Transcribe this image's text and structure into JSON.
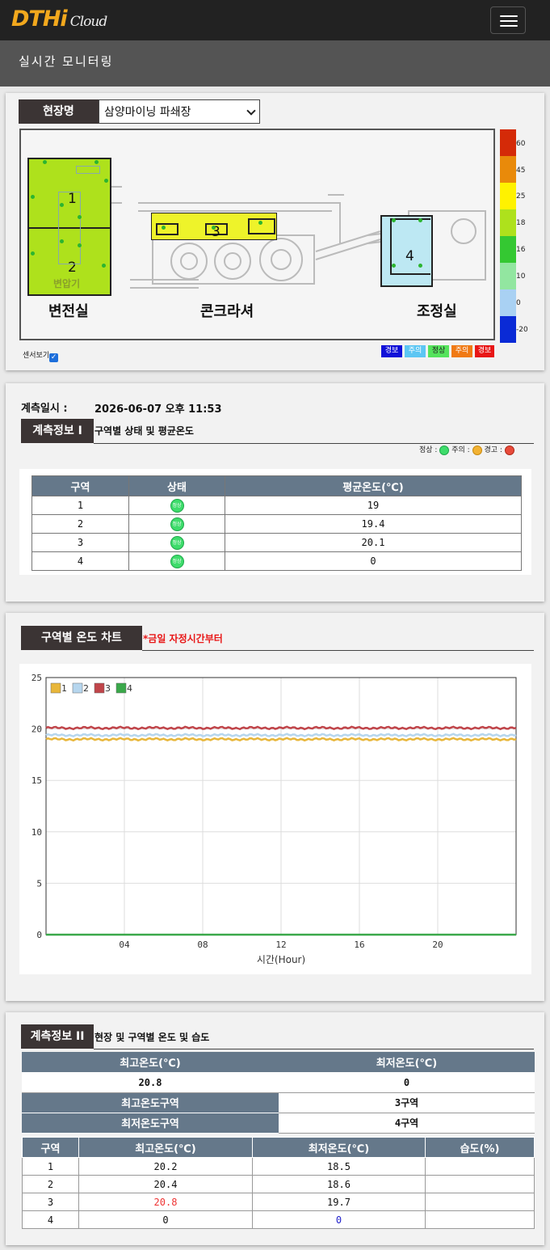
{
  "header": {
    "logo_main": "DTHi",
    "logo_sub": "Cloud",
    "menu_icon": "hamburger-menu-icon",
    "page_title": "실시간 모니터링"
  },
  "site": {
    "label": "현장명",
    "selected": "삼양마이닝 파쇄장",
    "sensor_toggle_label": "센서보기",
    "sensor_toggle_checked": true,
    "map": {
      "zones": [
        "1",
        "2",
        "3",
        "4"
      ],
      "rooms": [
        "변전실",
        "콘크라셔",
        "조정실"
      ],
      "sub_label": "변압기"
    },
    "scale": {
      "labels": [
        "60",
        "45",
        "25",
        "18",
        "16",
        "10",
        "0",
        "-20"
      ],
      "colors": [
        "#d42a08",
        "#e98a0a",
        "#fff200",
        "#aee11c",
        "#34c832",
        "#92e6a0",
        "#a9d1f3",
        "#0a2ad6"
      ]
    },
    "legend": [
      "경보",
      "주의",
      "정상",
      "주의",
      "경보"
    ],
    "legend_colors": [
      "#1010d8",
      "#5cc6f3",
      "#55e35c",
      "#f07a14",
      "#e81616"
    ]
  },
  "measure": {
    "datetime_label": "계측일시 :",
    "datetime_value": "2026-06-07 오후 11:53",
    "info1_tag": "계측정보 I",
    "info1_title": "구역별 상태 및 평균온도",
    "status_legend": [
      "정상 :",
      "주의 :",
      "경고 :"
    ],
    "status_colors": [
      "#3edc6b",
      "#f2b233",
      "#e84a3a"
    ],
    "table": {
      "headers": [
        "구역",
        "상태",
        "평균온도(℃)"
      ],
      "rows": [
        {
          "zone": "1",
          "status": "정상",
          "avg": "19"
        },
        {
          "zone": "2",
          "status": "정상",
          "avg": "19.4"
        },
        {
          "zone": "3",
          "status": "정상",
          "avg": "20.1"
        },
        {
          "zone": "4",
          "status": "정상",
          "avg": "0"
        }
      ]
    }
  },
  "chart_section": {
    "tag": "구역별 온도 차트",
    "note": "*금일 자정시간부터"
  },
  "chart_data": {
    "type": "line",
    "x": [
      0,
      2,
      4,
      6,
      8,
      10,
      12,
      14,
      16,
      18,
      20,
      22,
      24
    ],
    "xticks": [
      "04",
      "08",
      "12",
      "16",
      "20"
    ],
    "xtick_values": [
      4,
      8,
      12,
      16,
      20
    ],
    "xlim": [
      0,
      24
    ],
    "ylim": [
      0,
      25
    ],
    "yticks": [
      0,
      5,
      10,
      15,
      20,
      25
    ],
    "xlabel": "시간(Hour)",
    "ylabel": "",
    "grid": true,
    "legend_placement": "top-left",
    "series": [
      {
        "name": "1",
        "color": "#e8b63a",
        "values": [
          19,
          19,
          19,
          19,
          19,
          19,
          19,
          19,
          19,
          19,
          19,
          19,
          19
        ]
      },
      {
        "name": "2",
        "color": "#b6d6ee",
        "values": [
          19.4,
          19.4,
          19.4,
          19.4,
          19.4,
          19.4,
          19.4,
          19.4,
          19.4,
          19.4,
          19.4,
          19.4,
          19.4
        ]
      },
      {
        "name": "3",
        "color": "#c0454a",
        "values": [
          20.1,
          20.1,
          20.1,
          20.1,
          20.1,
          20.1,
          20.1,
          20.1,
          20.1,
          20.1,
          20.1,
          20.1,
          20.1
        ]
      },
      {
        "name": "4",
        "color": "#3aa84a",
        "values": [
          0,
          0,
          0,
          0,
          0,
          0,
          0,
          0,
          0,
          0,
          0,
          0,
          0
        ]
      }
    ]
  },
  "info2": {
    "tag": "계측정보 II",
    "title": "현장 및 구역별 온도 및 습도",
    "max_temp_label": "최고온도(℃)",
    "min_temp_label": "최저온도(℃)",
    "max_temp": "20.8",
    "min_temp": "0",
    "max_zone_label": "최고온도구역",
    "max_zone": "3구역",
    "min_zone_label": "최저온도구역",
    "min_zone": "4구역",
    "table": {
      "headers": [
        "구역",
        "최고온도(℃)",
        "최저온도(℃)",
        "습도(%)"
      ],
      "rows": [
        {
          "zone": "1",
          "max": "20.2",
          "min": "18.5",
          "hum": ""
        },
        {
          "zone": "2",
          "max": "20.4",
          "min": "18.6",
          "hum": ""
        },
        {
          "zone": "3",
          "max": "20.8",
          "min": "19.7",
          "hum": ""
        },
        {
          "zone": "4",
          "max": "0",
          "min": "0",
          "hum": ""
        }
      ]
    }
  }
}
